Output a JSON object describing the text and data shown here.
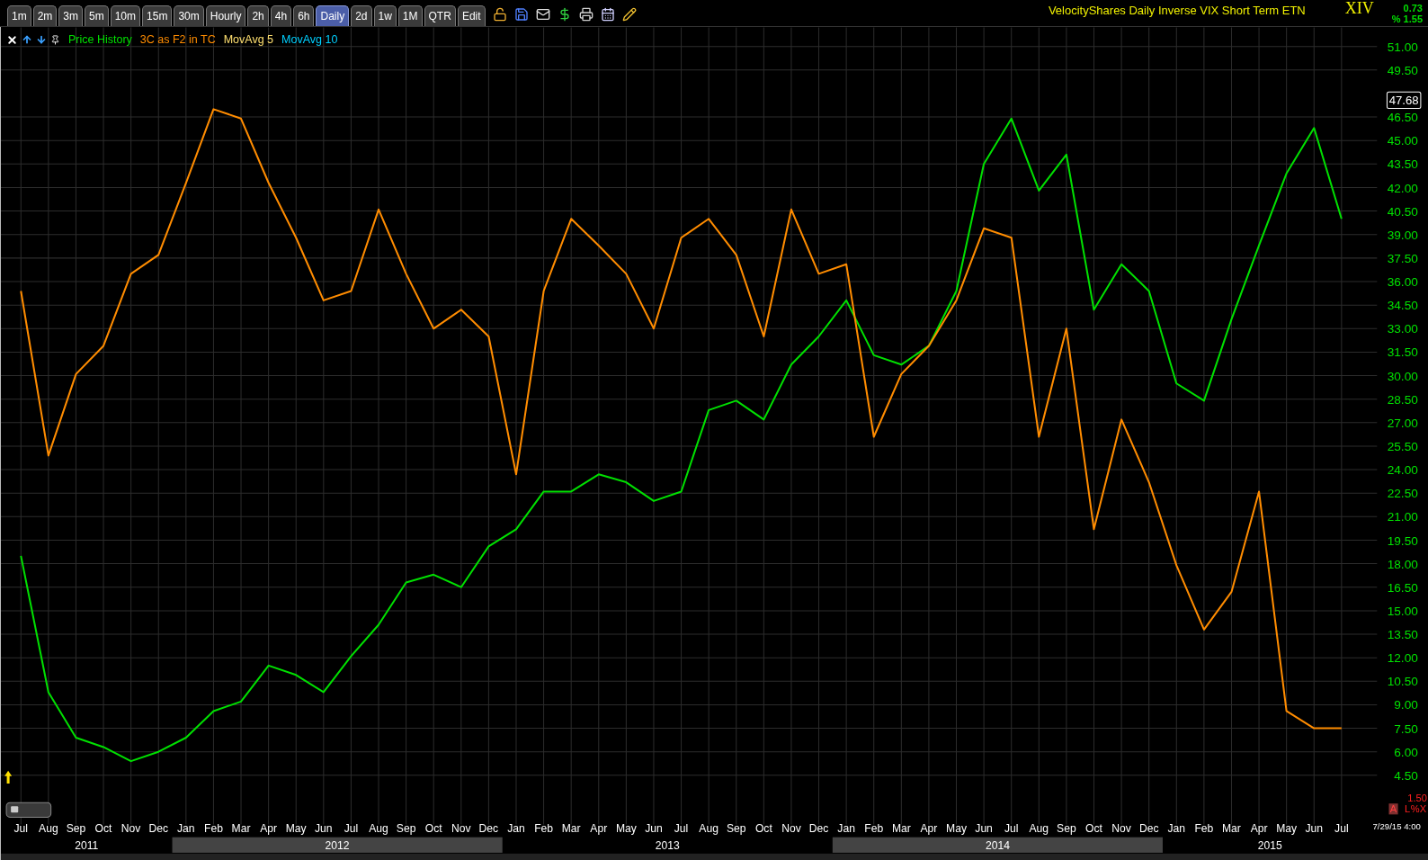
{
  "toolbar": {
    "tabs": [
      {
        "label": "1m",
        "selected": false
      },
      {
        "label": "2m",
        "selected": false
      },
      {
        "label": "3m",
        "selected": false
      },
      {
        "label": "5m",
        "selected": false
      },
      {
        "label": "10m",
        "selected": false
      },
      {
        "label": "15m",
        "selected": false
      },
      {
        "label": "30m",
        "selected": false
      },
      {
        "label": "Hourly",
        "selected": false
      },
      {
        "label": "2h",
        "selected": false
      },
      {
        "label": "4h",
        "selected": false
      },
      {
        "label": "6h",
        "selected": false
      },
      {
        "label": "Daily",
        "selected": true
      },
      {
        "label": "2d",
        "selected": false
      },
      {
        "label": "1w",
        "selected": false
      },
      {
        "label": "1M",
        "selected": false
      },
      {
        "label": "QTR",
        "selected": false
      },
      {
        "label": "Edit",
        "selected": false
      }
    ]
  },
  "security": {
    "name": "VelocityShares Daily Inverse VIX Short Term ETN",
    "symbol": "XIV",
    "change": "0.73",
    "change_percent": "% 1.55"
  },
  "legend": [
    {
      "label": "MovAvg 5",
      "color": "#ffe070"
    },
    {
      "label": "MovAvg 10",
      "color": "#00d0ff"
    }
  ],
  "chart": {
    "last_price": "47.68",
    "lower_reading": "1.50",
    "lower_buttons": [
      "A",
      "L",
      "%",
      "X"
    ],
    "timestamp": "7/29/15 4:00",
    "year_groups": [
      {
        "label": "2011",
        "shaded": false
      },
      {
        "label": "2012",
        "shaded": true
      },
      {
        "label": "2013",
        "shaded": false
      },
      {
        "label": "2014",
        "shaded": true
      },
      {
        "label": "2015",
        "shaded": false
      }
    ],
    "chart_data": {
      "type": "line",
      "grid": true,
      "categories": [
        "Jul",
        "Aug",
        "Sep",
        "Oct",
        "Nov",
        "Dec",
        "Jan",
        "Feb",
        "Mar",
        "Apr",
        "May",
        "Jun",
        "Jul",
        "Aug",
        "Sep",
        "Oct",
        "Nov",
        "Dec",
        "Jan",
        "Feb",
        "Mar",
        "Apr",
        "May",
        "Jun",
        "Jul",
        "Aug",
        "Sep",
        "Oct",
        "Nov",
        "Dec",
        "Jan",
        "Feb",
        "Mar",
        "Apr",
        "May",
        "Jun",
        "Jul",
        "Aug",
        "Sep",
        "Oct",
        "Nov",
        "Dec",
        "Jan",
        "Feb",
        "Mar",
        "Apr",
        "May",
        "Jun",
        "Jul"
      ],
      "series": [
        {
          "name": "Price History",
          "color": "#00e000",
          "values": [
            18.5,
            9.8,
            6.9,
            6.3,
            5.4,
            6.0,
            6.9,
            8.6,
            9.2,
            11.5,
            10.9,
            9.8,
            12.1,
            14.1,
            16.8,
            17.3,
            16.5,
            19.1,
            20.2,
            22.6,
            22.6,
            23.7,
            23.2,
            22.0,
            22.6,
            27.8,
            28.4,
            27.2,
            30.7,
            32.5,
            34.8,
            31.3,
            30.7,
            31.9,
            35.4,
            43.5,
            46.4,
            41.8,
            44.1,
            34.2,
            37.1,
            35.4,
            29.5,
            28.4,
            33.6,
            38.3,
            42.9,
            45.8,
            40.0
          ]
        },
        {
          "name": "3C as F2 in TC",
          "color": "#ff8c00",
          "values": [
            35.4,
            24.9,
            30.1,
            31.9,
            36.5,
            37.7,
            42.3,
            47.0,
            46.4,
            42.3,
            38.8,
            34.8,
            35.4,
            40.6,
            36.5,
            33.0,
            34.2,
            32.5,
            23.7,
            35.4,
            40.0,
            38.3,
            36.5,
            33.0,
            38.8,
            40.0,
            37.7,
            32.5,
            40.6,
            36.5,
            37.1,
            26.1,
            30.1,
            31.9,
            34.8,
            39.4,
            38.8,
            26.1,
            33.0,
            20.2,
            27.2,
            23.2,
            17.9,
            13.8,
            16.2,
            22.6,
            8.6,
            7.5,
            7.5
          ]
        }
      ],
      "ylim": [
        4.5,
        51
      ],
      "yticks": [
        {
          "value": 51,
          "label": "51.00"
        },
        {
          "value": 49.5,
          "label": "49.50"
        },
        {
          "value": 46.5,
          "label": "46.50"
        },
        {
          "value": 45,
          "label": "45.00"
        },
        {
          "value": 43.5,
          "label": "43.50"
        },
        {
          "value": 42,
          "label": "42.00"
        },
        {
          "value": 40.5,
          "label": "40.50"
        },
        {
          "value": 39,
          "label": "39.00"
        },
        {
          "value": 37.5,
          "label": "37.50"
        },
        {
          "value": 36,
          "label": "36.00"
        },
        {
          "value": 34.5,
          "label": "34.50"
        },
        {
          "value": 33,
          "label": "33.00"
        },
        {
          "value": 31.5,
          "label": "31.50"
        },
        {
          "value": 30,
          "label": "30.00"
        },
        {
          "value": 28.5,
          "label": "28.50"
        },
        {
          "value": 27,
          "label": "27.00"
        },
        {
          "value": 25.5,
          "label": "25.50"
        },
        {
          "value": 24,
          "label": "24.00"
        },
        {
          "value": 22.5,
          "label": "22.50"
        },
        {
          "value": 21,
          "label": "21.00"
        },
        {
          "value": 19.5,
          "label": "19.50"
        },
        {
          "value": 18,
          "label": "18.00"
        },
        {
          "value": 16.5,
          "label": "16.50"
        },
        {
          "value": 15,
          "label": "15.00"
        },
        {
          "value": 13.5,
          "label": "13.50"
        },
        {
          "value": 12,
          "label": "12.00"
        },
        {
          "value": 10.5,
          "label": "10.50"
        },
        {
          "value": 9,
          "label": "9.00"
        },
        {
          "value": 7.5,
          "label": "7.50"
        },
        {
          "value": 6,
          "label": "6.00"
        },
        {
          "value": 4.5,
          "label": "4.50"
        }
      ]
    }
  }
}
